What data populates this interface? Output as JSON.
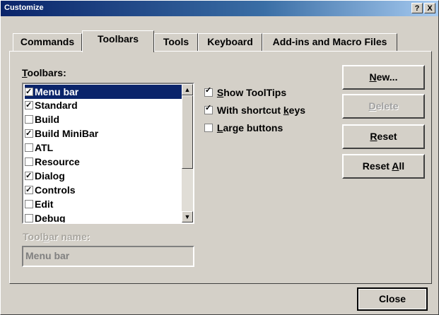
{
  "window": {
    "title": "Customize",
    "help_glyph": "?",
    "close_glyph": "X"
  },
  "tabs": [
    {
      "label": "Commands"
    },
    {
      "label": "Toolbars"
    },
    {
      "label": "Tools"
    },
    {
      "label": "Keyboard"
    },
    {
      "label": "Add-ins and Macro Files"
    }
  ],
  "toolbars": {
    "label_prefix": "T",
    "label_rest": "oolbars:",
    "items": [
      {
        "label": "Menu bar",
        "checked": true,
        "selected": true
      },
      {
        "label": "Standard",
        "checked": true,
        "selected": false
      },
      {
        "label": "Build",
        "checked": false,
        "selected": false
      },
      {
        "label": "Build MiniBar",
        "checked": true,
        "selected": false
      },
      {
        "label": "ATL",
        "checked": false,
        "selected": false
      },
      {
        "label": "Resource",
        "checked": false,
        "selected": false
      },
      {
        "label": "Dialog",
        "checked": true,
        "selected": false
      },
      {
        "label": "Controls",
        "checked": true,
        "selected": false
      },
      {
        "label": "Edit",
        "checked": false,
        "selected": false
      },
      {
        "label": "Debug",
        "checked": false,
        "selected": false
      }
    ]
  },
  "options": {
    "show_tooltips": {
      "label_prefix": "S",
      "label_rest": "how ToolTips",
      "checked": true
    },
    "shortcut_keys": {
      "label_before": "With shortcut ",
      "label_u": "k",
      "label_after": "eys",
      "checked": true
    },
    "large_buttons": {
      "label_prefix": "L",
      "label_rest": "arge buttons",
      "checked": false
    }
  },
  "buttons": {
    "new": {
      "u": "N",
      "rest": "ew..."
    },
    "delete": {
      "u": "D",
      "rest": "elete"
    },
    "reset": {
      "u": "R",
      "rest": "eset"
    },
    "reset_all": {
      "before": "Reset ",
      "u": "A",
      "rest": "ll"
    },
    "close": "Close"
  },
  "toolbar_name": {
    "label_before": "Tool",
    "label_u": "b",
    "label_after": "ar name:",
    "value": "Menu bar"
  },
  "colors": {
    "face": "#d4d0c8",
    "title_bar": "#0a246a",
    "selection": "#0a246a"
  }
}
